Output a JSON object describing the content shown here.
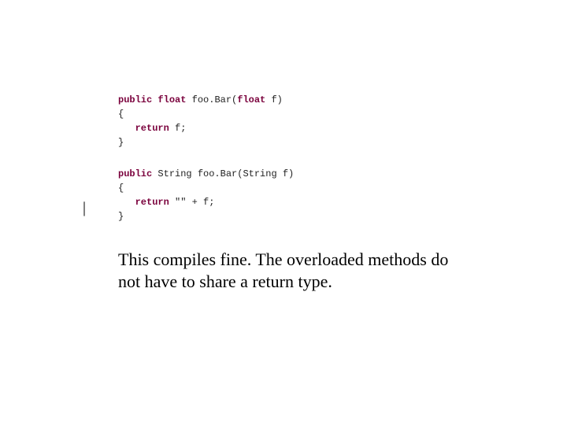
{
  "code": {
    "block1": {
      "kw_public": "public",
      "kw_float": "float",
      "sig_tail": " foo.Bar(",
      "kw_float2": "float",
      "sig_close": " f)",
      "open_brace": "{",
      "kw_return": "return",
      "ret_tail": " f;",
      "close_brace": "}"
    },
    "block2": {
      "kw_public": "public",
      "sig_tail": " String foo.Bar(String f)",
      "open_brace": "{",
      "kw_return": "return",
      "ret_tail": " \"\" + f;",
      "close_brace": "}"
    }
  },
  "caption": "This compiles fine.  The overloaded methods do not have to share a return type.",
  "cursor": "|"
}
